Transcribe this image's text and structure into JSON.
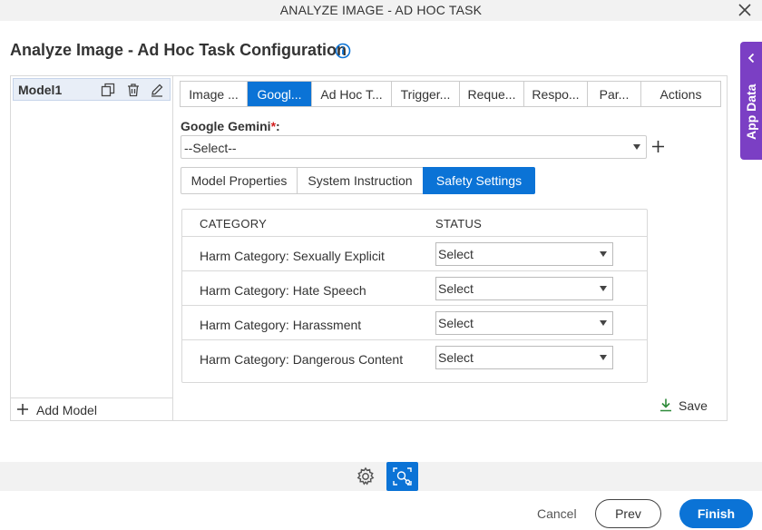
{
  "window": {
    "title": "ANALYZE IMAGE - AD HOC TASK"
  },
  "page": {
    "heading": "Analyze Image - Ad Hoc Task Configuration"
  },
  "models": {
    "items": [
      {
        "label": "Model1"
      }
    ],
    "add_label": "Add Model"
  },
  "tabs": [
    {
      "label": "Image ..."
    },
    {
      "label": "Googl...",
      "active": true
    },
    {
      "label": "Ad Hoc T..."
    },
    {
      "label": "Trigger..."
    },
    {
      "label": "Reque..."
    },
    {
      "label": "Respo..."
    },
    {
      "label": "Par..."
    },
    {
      "label": "Actions"
    }
  ],
  "gemini": {
    "label": "Google Gemini",
    "required_mark": "*",
    "label_suffix": ":",
    "value": "--Select--"
  },
  "subtabs": [
    {
      "label": "Model Properties"
    },
    {
      "label": "System Instruction"
    },
    {
      "label": "Safety Settings",
      "active": true
    }
  ],
  "safety": {
    "headers": {
      "category": "CATEGORY",
      "status": "STATUS"
    },
    "rows": [
      {
        "category": "Harm Category: Sexually Explicit",
        "status": "Select"
      },
      {
        "category": "Harm Category: Hate Speech",
        "status": "Select"
      },
      {
        "category": "Harm Category: Harassment",
        "status": "Select"
      },
      {
        "category": "Harm Category: Dangerous Content",
        "status": "Select"
      }
    ],
    "save_label": "Save"
  },
  "app_data": {
    "label": "App Data"
  },
  "footer": {
    "cancel": "Cancel",
    "prev": "Prev",
    "finish": "Finish"
  },
  "colors": {
    "accent": "#0b73d6",
    "app_data": "#7b3fc4",
    "required": "#d21f1f",
    "save_icon": "#2e8b3a"
  },
  "icons": [
    "close-icon",
    "info-icon",
    "copy-icon",
    "trash-icon",
    "edit-icon",
    "plus-icon",
    "chevron-down-icon",
    "download-icon",
    "chevron-left-icon",
    "gear-icon",
    "ai-image-icon"
  ]
}
